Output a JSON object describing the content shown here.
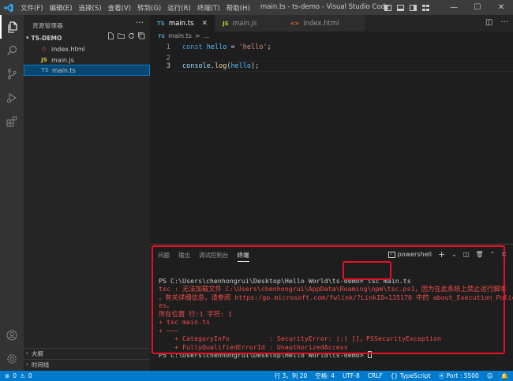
{
  "window": {
    "title": "main.ts - ts-demo - Visual Studio Code",
    "menu": [
      "文件(F)",
      "编辑(E)",
      "选择(S)",
      "查看(V)",
      "转到(G)",
      "运行(R)",
      "终端(T)",
      "帮助(H)"
    ],
    "controls": {
      "minimize": "—",
      "maximize": "☐",
      "close": "✕"
    }
  },
  "sidebar": {
    "title": "资源管理器",
    "more": "···",
    "root": "TS-DEMO",
    "files": [
      {
        "name": "index.html",
        "icon": "html-file-icon"
      },
      {
        "name": "main.js",
        "icon": "js-file-icon"
      },
      {
        "name": "main.ts",
        "icon": "ts-file-icon",
        "selected": true
      }
    ],
    "sections": [
      "大纲",
      "时间线"
    ]
  },
  "tabs": [
    {
      "label": "main.ts",
      "icon": "TS",
      "active": true,
      "close": "✕"
    },
    {
      "label": "main.js",
      "icon": "JS",
      "active": false
    },
    {
      "label": "index.html",
      "icon": "<>",
      "active": false
    }
  ],
  "breadcrumb": {
    "file": "main.ts",
    "sep": ">",
    "rest": "..."
  },
  "editor": {
    "lines": [
      {
        "num": "1",
        "parts": [
          [
            "kw",
            "const"
          ],
          [
            "plain",
            " "
          ],
          [
            "var",
            "hello"
          ],
          [
            "plain",
            " = "
          ],
          [
            "str",
            "'hello'"
          ],
          [
            "plain",
            ";"
          ]
        ]
      },
      {
        "num": "2",
        "parts": []
      },
      {
        "num": "3",
        "parts": [
          [
            "prm",
            "console"
          ],
          [
            "plain",
            "."
          ],
          [
            "fn",
            "log"
          ],
          [
            "plain",
            "("
          ],
          [
            "var",
            "hello"
          ],
          [
            "plain",
            ");"
          ]
        ]
      }
    ]
  },
  "panel": {
    "tabs": [
      "问题",
      "输出",
      "调试控制台",
      "终端"
    ],
    "active_tab": "终端",
    "shell": "powershell",
    "add": "+",
    "chevron": "⌄",
    "terminal": {
      "prompt1": "PS C:\\Users\\chenhongrui\\Desktop\\Hello World\\ts-demo> ",
      "command": "tsc main.ts",
      "error_lines": [
        "tsc : 无法加载文件 C:\\Users\\chenhongrui\\AppData\\Roaming\\npm\\tsc.ps1，因为在此系统上禁止运行脚本",
        "。有关详细信息，请参阅 https:/go.microsoft.com/fwlink/?LinkID=135170 中的 about_Execution_Polici",
        "es。",
        "所在位置 行:1 字符: 1",
        "+ tsc main.ts",
        "+ ~~~",
        "    + CategoryInfo          : SecurityError: (:) []，PSSecurityException",
        "    + FullyQualifiedErrorId : UnauthorizedAccess"
      ],
      "prompt2": "PS C:\\Users\\chenhongrui\\Desktop\\Hello World\\ts-demo> "
    }
  },
  "statusbar": {
    "errors": "0",
    "warnings": "0",
    "position": "行 3，列 20",
    "spaces": "空格: 4",
    "encoding": "UTF-8",
    "eol": "CRLF",
    "language": "TypeScript",
    "port": "Port : 5500"
  },
  "colors": {
    "accent": "#007acc",
    "highlight": "#e81123",
    "error": "#f14c4c"
  }
}
